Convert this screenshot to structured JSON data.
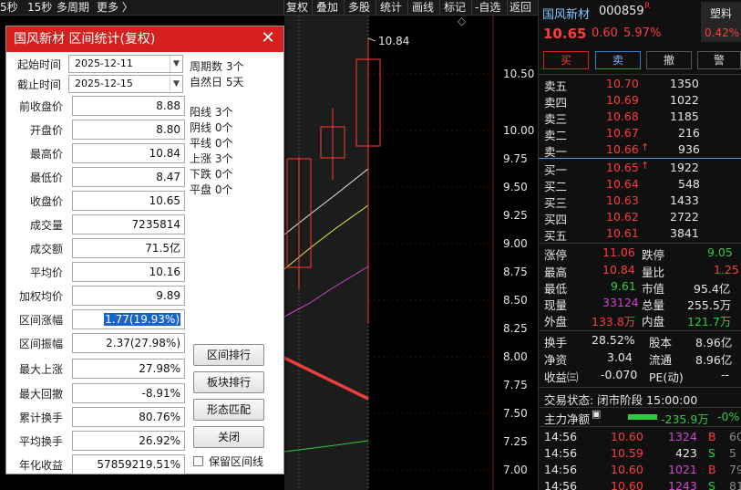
{
  "toolbar": {
    "left_items": [
      "5秒",
      "15秒",
      "多周期",
      "更多 〉"
    ],
    "right_items": [
      "复权",
      "叠加",
      "多股",
      "统计",
      "画线",
      "标记",
      "-自选",
      "返回"
    ]
  },
  "chart": {
    "y_axis_labels": [
      "10.50",
      "10.00",
      "9.75",
      "9.50",
      "9.25",
      "9.00",
      "8.75",
      "8.50",
      "8.25",
      "8.00",
      "7.75",
      "7.50",
      "7.25",
      "7.00"
    ],
    "high_marker": "10.84"
  },
  "dialog": {
    "title": "国风新材 区间统计(复权)",
    "start_label": "起始时间",
    "start_value": "2025-12-11",
    "end_label": "截止时间",
    "end_value": "2025-12-15",
    "fields": [
      {
        "label": "前收盘价",
        "value": "8.88"
      },
      {
        "label": "开盘价",
        "value": "8.80"
      },
      {
        "label": "最高价",
        "value": "10.84"
      },
      {
        "label": "最低价",
        "value": "8.47"
      },
      {
        "label": "收盘价",
        "value": "10.65"
      },
      {
        "label": "成交量",
        "value": "7235814"
      },
      {
        "label": "成交额",
        "value": "71.5亿"
      },
      {
        "label": "平均价",
        "value": "10.16"
      },
      {
        "label": "加权均价",
        "value": "9.89"
      },
      {
        "label": "区间涨幅",
        "value": "1.77(19.93%)"
      },
      {
        "label": "区间振幅",
        "value": "2.37(27.98%)"
      },
      {
        "label": "最大上涨",
        "value": "27.98%"
      },
      {
        "label": "最大回撤",
        "value": "-8.91%"
      },
      {
        "label": "累计换手",
        "value": "80.76%"
      },
      {
        "label": "平均换手",
        "value": "26.92%"
      },
      {
        "label": "年化收益",
        "value": "57859219.51%"
      }
    ],
    "stats": [
      "周期数 3个",
      "自然日 5天",
      "阳线 3个",
      "阴线 0个",
      "平线 0个",
      "上涨 3个",
      "下跌 0个",
      "平盘 0个"
    ],
    "buttons": [
      "区间排行",
      "板块排行",
      "形态匹配",
      "关闭"
    ],
    "checkbox_label": "保留区间线"
  },
  "quote": {
    "name": "国风新材",
    "code": "000859",
    "r_badge": "R",
    "sector": "塑料",
    "sector_pct": "0.42%",
    "price": "10.65",
    "change": "0.60",
    "change_pct": "5.97%",
    "tabs": [
      "买",
      "卖",
      "撤",
      "警"
    ],
    "asks": [
      {
        "label": "卖五",
        "price": "10.70",
        "vol": "1350"
      },
      {
        "label": "卖四",
        "price": "10.69",
        "vol": "1022"
      },
      {
        "label": "卖三",
        "price": "10.68",
        "vol": "1185"
      },
      {
        "label": "卖二",
        "price": "10.67",
        "vol": "216"
      },
      {
        "label": "卖一",
        "price": "10.66",
        "vol": "936"
      }
    ],
    "bids": [
      {
        "label": "买一",
        "price": "10.65",
        "vol": "1922"
      },
      {
        "label": "买二",
        "price": "10.64",
        "vol": "548"
      },
      {
        "label": "买三",
        "price": "10.63",
        "vol": "1433"
      },
      {
        "label": "买四",
        "price": "10.62",
        "vol": "2722"
      },
      {
        "label": "买五",
        "price": "10.61",
        "vol": "3841"
      }
    ],
    "stats_left": [
      {
        "label": "涨停",
        "value": "11.06"
      },
      {
        "label": "最高",
        "value": "10.84"
      },
      {
        "label": "最低",
        "value": "9.61"
      },
      {
        "label": "现量",
        "value": "33124"
      },
      {
        "label": "外盘",
        "value": "133.8万"
      }
    ],
    "stats_right": [
      {
        "label": "跌停",
        "value": "9.05"
      },
      {
        "label": "量比",
        "value": "1.25"
      },
      {
        "label": "市值",
        "value": "95.4亿"
      },
      {
        "label": "总量",
        "value": "255.5万"
      },
      {
        "label": "内盘",
        "value": "121.7万"
      }
    ],
    "stats2_left": [
      {
        "label": "换手",
        "value": "28.52%"
      },
      {
        "label": "净资",
        "value": "3.04"
      },
      {
        "label": "收益㈢",
        "value": "-0.070"
      }
    ],
    "stats2_right": [
      {
        "label": "股本",
        "value": "8.96亿"
      },
      {
        "label": "流通",
        "value": "8.96亿"
      },
      {
        "label": "PE(动)",
        "value": "--"
      }
    ],
    "trade_status": "交易状态: 闭市阶段 15:00:00",
    "main_flow_label": "主力净额",
    "main_flow_value": "-235.9万",
    "main_flow_pct": "-0%",
    "ticks": [
      {
        "time": "14:56",
        "price": "10.60",
        "vol": "1324",
        "side": "B",
        "n": "60"
      },
      {
        "time": "14:56",
        "price": "10.59",
        "vol": "423",
        "side": "S",
        "n": "5"
      },
      {
        "time": "14:56",
        "price": "10.60",
        "vol": "1021",
        "side": "B",
        "n": "79"
      },
      {
        "time": "14:56",
        "price": "10.60",
        "vol": "1243",
        "side": "S",
        "n": "81"
      }
    ]
  }
}
